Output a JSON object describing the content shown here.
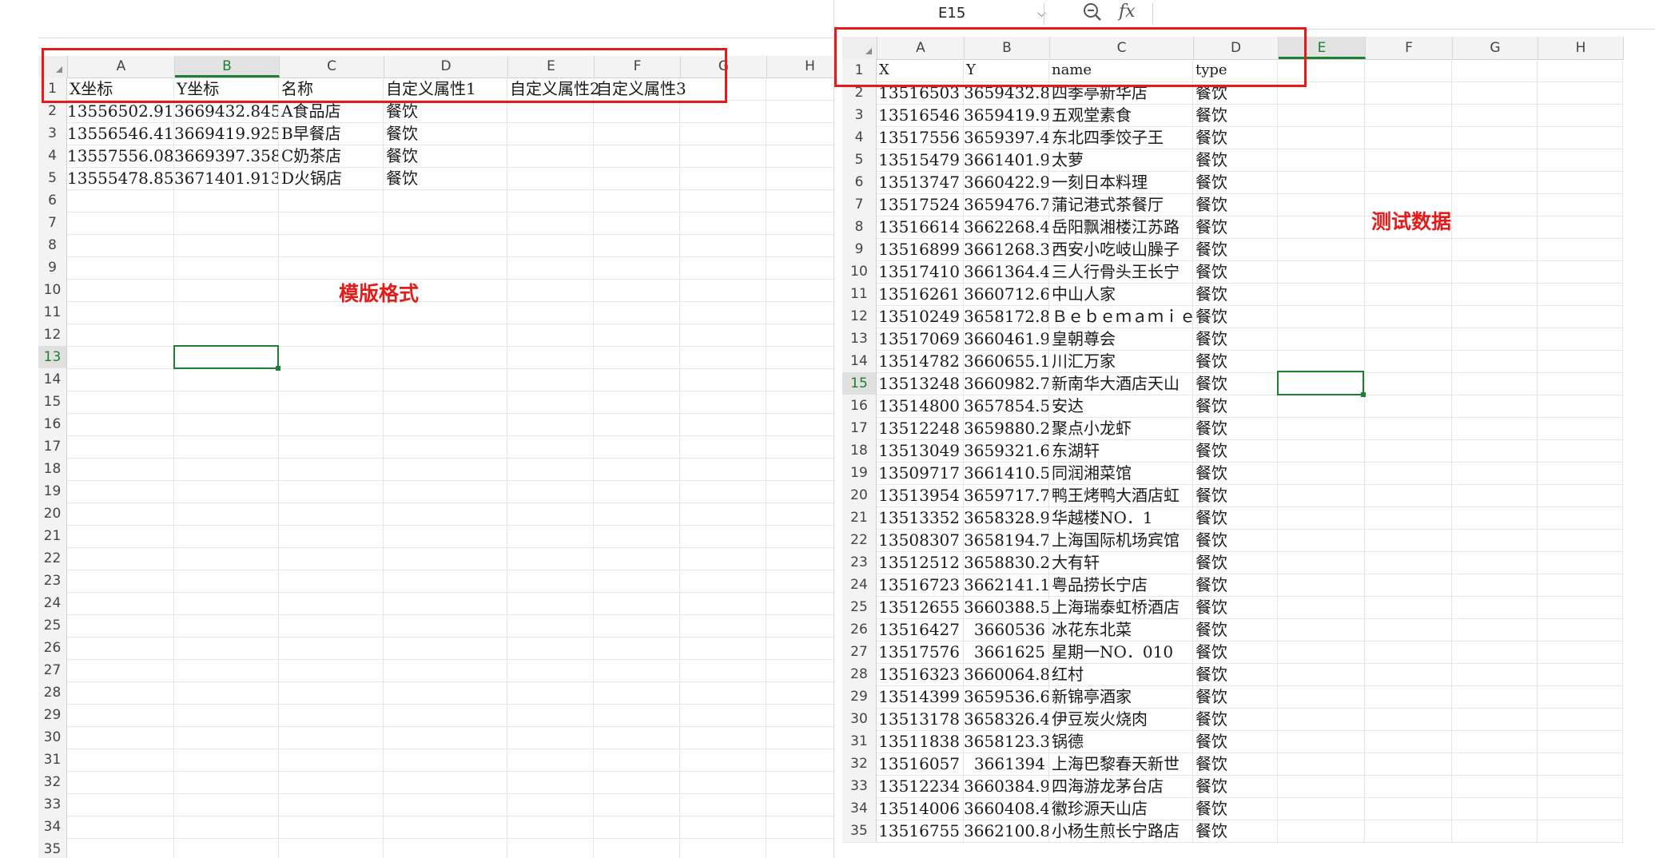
{
  "left": {
    "annotation": "模版格式",
    "columns": [
      "A",
      "B",
      "C",
      "D",
      "E",
      "F",
      "G",
      "H"
    ],
    "selected_column": "B",
    "selected_row": 13,
    "header_row": [
      "X坐标",
      "Y坐标",
      "名称",
      "自定义属性1",
      "自定义属性2",
      "自定义属性3",
      "",
      ""
    ],
    "rows": [
      [
        "13556502.91",
        "3669432.845",
        "A食品店",
        "餐饮"
      ],
      [
        "13556546.41",
        "3669419.925",
        "B早餐店",
        "餐饮"
      ],
      [
        "13557556.08",
        "3669397.358",
        "C奶茶店",
        "餐饮"
      ],
      [
        "13555478.85",
        "3671401.913",
        "D火锅店",
        "餐饮"
      ]
    ],
    "row_labels": [
      "1",
      "2",
      "3",
      "4",
      "5",
      "6",
      "7",
      "8",
      "9",
      "10",
      "11",
      "12",
      "13",
      "14",
      "15",
      "16",
      "17",
      "18",
      "19",
      "20",
      "21",
      "22",
      "23",
      "24",
      "25",
      "26",
      "27",
      "28",
      "29",
      "30",
      "31",
      "32",
      "33",
      "34",
      "35"
    ]
  },
  "right": {
    "name_box": "E15",
    "fx_label": "fx",
    "zoom_icon": "zoom-icon",
    "annotation": "测试数据",
    "columns": [
      "A",
      "B",
      "C",
      "D",
      "E",
      "F",
      "G",
      "H"
    ],
    "selected_column": "E",
    "selected_row": 15,
    "header_row": [
      "X",
      "Y",
      "name",
      "type"
    ],
    "rows": [
      [
        "13516503",
        "3659432.8",
        "四季亭新华店",
        "餐饮"
      ],
      [
        "13516546",
        "3659419.9",
        "五观堂素食",
        "餐饮"
      ],
      [
        "13517556",
        "3659397.4",
        "东北四季饺子王",
        "餐饮"
      ],
      [
        "13515479",
        "3661401.9",
        "太萝",
        "餐饮"
      ],
      [
        "13513747",
        "3660422.9",
        "一刻日本料理",
        "餐饮"
      ],
      [
        "13517524",
        "3659476.7",
        "蒲记港式茶餐厅",
        "餐饮"
      ],
      [
        "13516614",
        "3662268.4",
        "岳阳飘湘楼江苏路",
        "餐饮"
      ],
      [
        "13516899",
        "3661268.3",
        "西安小吃岐山臊子",
        "餐饮"
      ],
      [
        "13517410",
        "3661364.4",
        "三人行骨头王长宁",
        "餐饮"
      ],
      [
        "13516261",
        "3660712.6",
        "中山人家",
        "餐饮"
      ],
      [
        "13510249",
        "3658172.8",
        "Ｂｅｂｅｍａｍｉｅ",
        "餐饮"
      ],
      [
        "13517069",
        "3660461.9",
        "皇朝尊会",
        "餐饮"
      ],
      [
        "13514782",
        "3660655.1",
        "川汇万家",
        "餐饮"
      ],
      [
        "13513248",
        "3660982.7",
        "新南华大酒店天山",
        "餐饮"
      ],
      [
        "13514800",
        "3657854.5",
        "安达",
        "餐饮"
      ],
      [
        "13512248",
        "3659880.2",
        "聚点小龙虾",
        "餐饮"
      ],
      [
        "13513049",
        "3659321.6",
        "东湖轩",
        "餐饮"
      ],
      [
        "13509717",
        "3661410.5",
        "同润湘菜馆",
        "餐饮"
      ],
      [
        "13513954",
        "3659717.7",
        "鸭王烤鸭大酒店虹",
        "餐饮"
      ],
      [
        "13513352",
        "3658328.9",
        "华越楼NO．1",
        "餐饮"
      ],
      [
        "13508307",
        "3658194.7",
        "上海国际机场宾馆",
        "餐饮"
      ],
      [
        "13512512",
        "3658830.2",
        "大有轩",
        "餐饮"
      ],
      [
        "13516723",
        "3662141.1",
        "粤品捞长宁店",
        "餐饮"
      ],
      [
        "13512655",
        "3660388.5",
        "上海瑞泰虹桥酒店",
        "餐饮"
      ],
      [
        "13516427",
        "3660536",
        "冰花东北菜",
        "餐饮"
      ],
      [
        "13517576",
        "3661625",
        "星期一NO．010",
        "餐饮"
      ],
      [
        "13516323",
        "3660064.8",
        "红村",
        "餐饮"
      ],
      [
        "13514399",
        "3659536.6",
        "新锦亭酒家",
        "餐饮"
      ],
      [
        "13513178",
        "3658326.4",
        "伊豆炭火烧肉",
        "餐饮"
      ],
      [
        "13511838",
        "3658123.3",
        "锅德",
        "餐饮"
      ],
      [
        "13516057",
        "3661394",
        "上海巴黎春天新世",
        "餐饮"
      ],
      [
        "13512234",
        "3660384.9",
        "四海游龙茅台店",
        "餐饮"
      ],
      [
        "13514006",
        "3660408.4",
        "徽珍源天山店",
        "餐饮"
      ],
      [
        "13516755",
        "3662100.8",
        "小杨生煎长宁路店",
        "餐饮"
      ]
    ],
    "row_labels": [
      "1",
      "2",
      "3",
      "4",
      "5",
      "6",
      "7",
      "8",
      "9",
      "10",
      "11",
      "12",
      "13",
      "14",
      "15",
      "16",
      "17",
      "18",
      "19",
      "20",
      "21",
      "22",
      "23",
      "24",
      "25",
      "26",
      "27",
      "28",
      "29",
      "30",
      "31",
      "32",
      "33",
      "34",
      "35"
    ]
  }
}
